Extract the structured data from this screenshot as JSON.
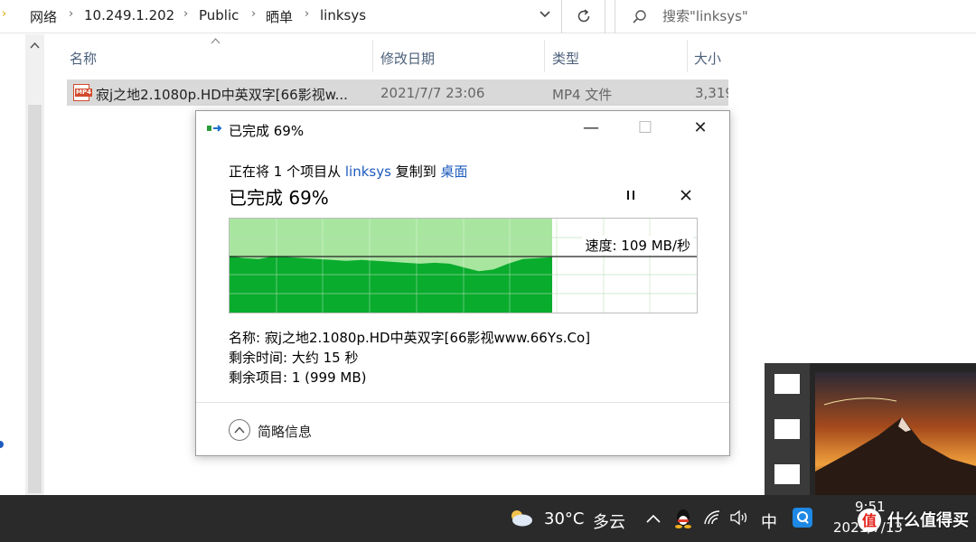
{
  "address": {
    "crumbs": [
      "网络",
      "10.249.1.202",
      "Public",
      "晒单",
      "linksys"
    ],
    "search_placeholder": "搜索\"linksys\""
  },
  "file_list": {
    "columns": [
      "名称",
      "修改日期",
      "类型",
      "大小"
    ],
    "rows": [
      {
        "name": "寂j之地2.1080p.HD中英双字[66影视w...",
        "date": "2021/7/7 23:06",
        "type": "MP4 文件",
        "size": "3,319",
        "icon_label": "MP4"
      }
    ]
  },
  "dialog": {
    "title": "已完成 69%",
    "copy_prefix": "正在将 1 个项目从",
    "source": "linksys",
    "copy_middle": "复制到",
    "dest": "桌面",
    "percent_text": "已完成 69%",
    "progress": 0.69,
    "speed_text": "速度: 109 MB/秒",
    "name_line": "名称: 寂j之地2.1080p.HD中英双字[66影视www.66Ys.Co]",
    "time_line": "剩余时间: 大约 15 秒",
    "items_line": "剩余项目: 1 (999 MB)",
    "brief_label": "简略信息",
    "pause_glyph": "II",
    "cancel_glyph": "✕",
    "min_glyph": "—",
    "max_glyph": "☐",
    "close_glyph": "✕"
  },
  "taskbar": {
    "temperature": "30°C",
    "condition": "多云",
    "ime": "中",
    "time": "9:51",
    "date": "2021/7/13",
    "watermark": "什么值得买"
  },
  "colors": {
    "graph_fill": "#0aac2d",
    "graph_bg_done": "#a8e6a0",
    "link": "#1e5bbd",
    "taskbar": "#2a2a2a",
    "row_selected": "#d9d9d9"
  },
  "icons": [
    "chevron-right-icon",
    "chevron-down-icon",
    "refresh-icon",
    "search-icon",
    "mp4-file-icon",
    "copy-icon",
    "pause-icon",
    "cancel-icon",
    "expand-up-icon",
    "weather-cloud-icon",
    "qq-icon",
    "wifi-icon",
    "volume-icon",
    "q-app-icon"
  ]
}
